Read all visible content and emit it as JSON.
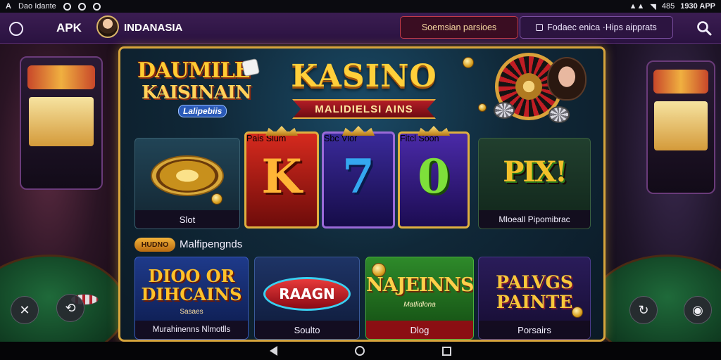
{
  "status_bar": {
    "left_text": "Dao Idante",
    "right_text": "1930 APP",
    "battery": "485"
  },
  "header": {
    "app_label": "APK",
    "brand": "INDANASIA",
    "promo_button": "Soemsian parsioes",
    "secondary_button": "Fodaec enica ·Hips aipprats"
  },
  "banner": {
    "logo_line1": "DAUMILE",
    "logo_line2": "KAISINAIN",
    "logo_tag": "Lalipebiis",
    "title": "KASINO",
    "subtitle": "MALIDIELSI AINS"
  },
  "games_row1": [
    {
      "label": "Slot",
      "glyph": ""
    },
    {
      "label": "Pais Slum",
      "glyph": "K"
    },
    {
      "label": "Sbc Vlor",
      "glyph": "7"
    },
    {
      "label": "Fitcl Soon",
      "glyph": "0"
    },
    {
      "label": "Mloeall Pipomibrac",
      "glyph": "PIX!"
    }
  ],
  "section": {
    "badge": "HUDNO",
    "title": "Malfipengnds"
  },
  "games_row2": [
    {
      "label": "Murahinenns Nlmotlls",
      "title_line1": "DIOO OR",
      "title_line2": "DIHCAINS",
      "sub": "Sasaes"
    },
    {
      "label": "Soulto",
      "title_line1": "RAAGN"
    },
    {
      "label": "Dlog",
      "title_line1": "NAJEINNS",
      "sub": "Matlidlona"
    },
    {
      "label": "Porsairs",
      "title_line1": "PALVGS",
      "title_line2": "PAINTE"
    }
  ],
  "colors": {
    "accent_gold": "#d7a53c",
    "header_purple": "#3b1d52",
    "panel_teal": "#102838"
  }
}
